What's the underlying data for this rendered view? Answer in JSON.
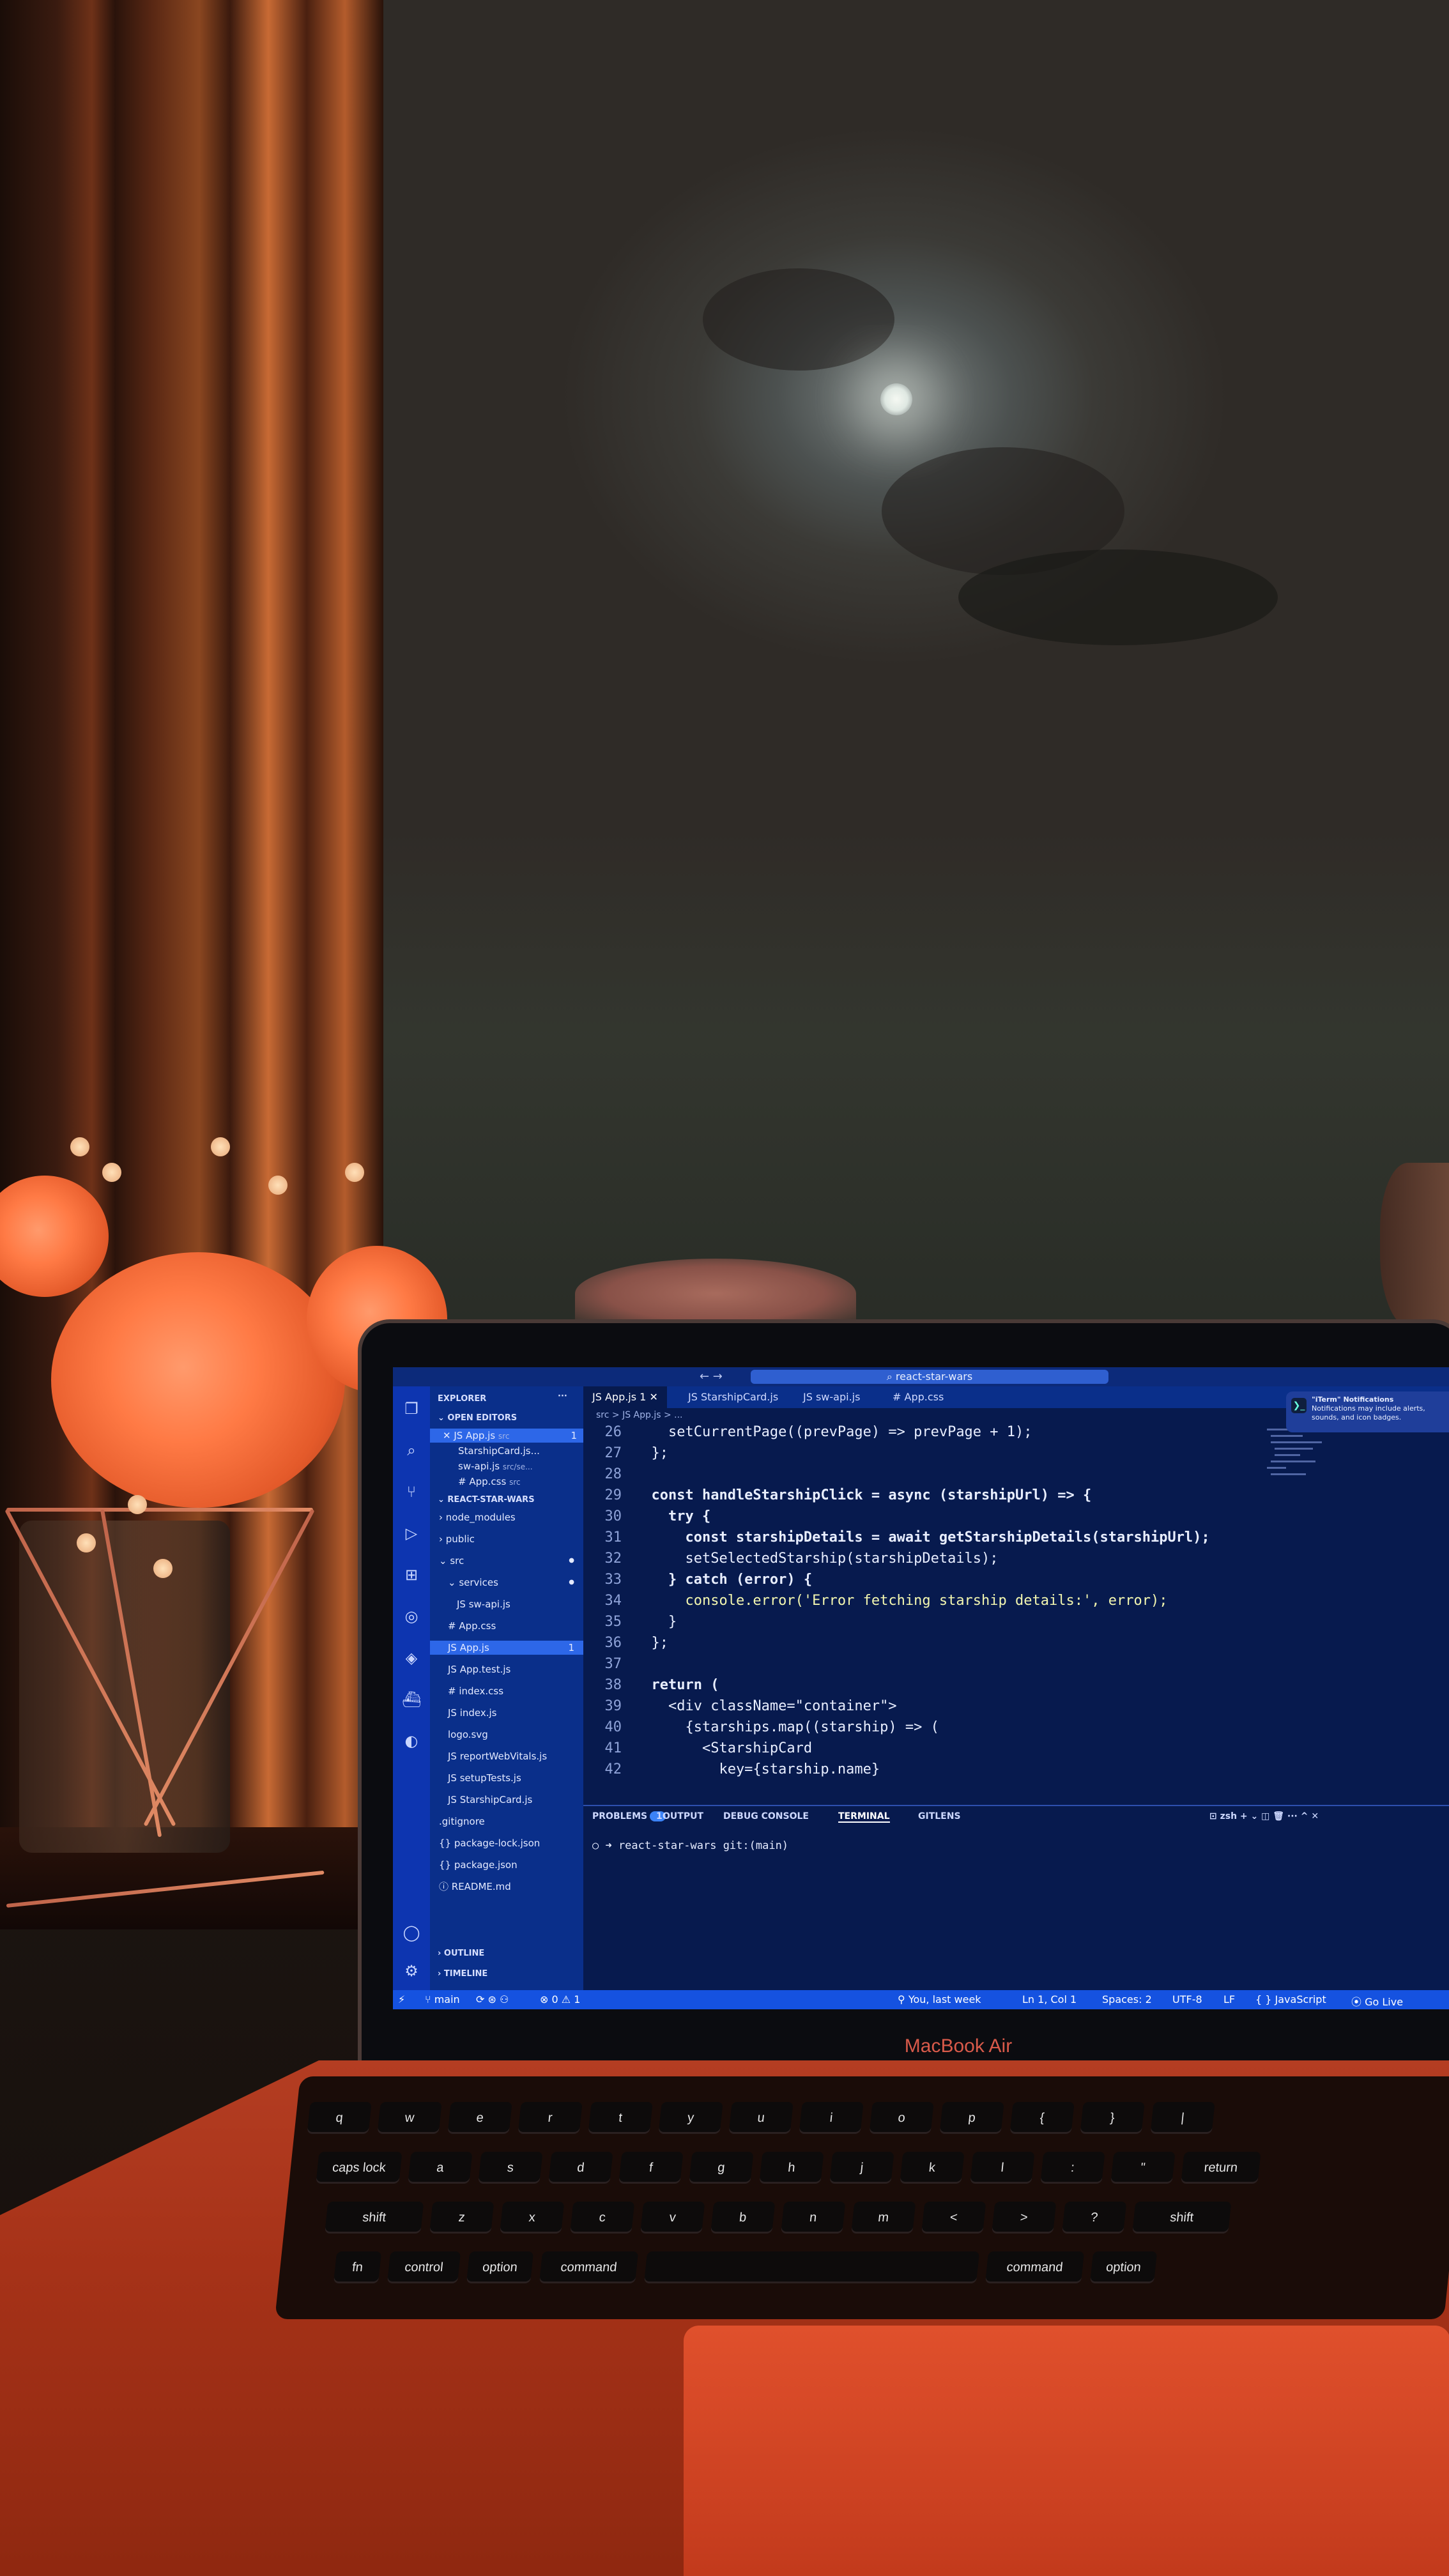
{
  "scene": {
    "laptop_brand": "MacBook Air"
  },
  "vscode": {
    "title": "react-star-wars",
    "notification": {
      "title": "\"iTerm\" Notifications",
      "body": "Notifications may include alerts, sounds, and icon badges."
    },
    "sidebar": {
      "header": "EXPLORER",
      "header_more": "···",
      "open_editors_label": "OPEN EDITORS",
      "open_editors": [
        {
          "close": "✕",
          "name": "JS App.js",
          "path": "src",
          "badge": "1"
        },
        {
          "name": "StarshipCard.js...",
          "path": ""
        },
        {
          "name": "sw-api.js",
          "path": "src/se..."
        },
        {
          "name": "# App.css",
          "path": "src"
        }
      ],
      "project_label": "REACT-STAR-WARS",
      "tree": [
        {
          "name": "node_modules",
          "indent": 0,
          "arrow": "›"
        },
        {
          "name": "public",
          "indent": 0,
          "arrow": "›"
        },
        {
          "name": "src",
          "indent": 0,
          "arrow": "⌄",
          "dot": "●"
        },
        {
          "name": "services",
          "indent": 1,
          "arrow": "⌄",
          "dot": "●"
        },
        {
          "name": "JS sw-api.js",
          "indent": 2
        },
        {
          "name": "# App.css",
          "indent": 1
        },
        {
          "name": "JS App.js",
          "indent": 1,
          "active": true,
          "badge": "1"
        },
        {
          "name": "JS App.test.js",
          "indent": 1
        },
        {
          "name": "# index.css",
          "indent": 1
        },
        {
          "name": "JS index.js",
          "indent": 1
        },
        {
          "name": "logo.svg",
          "indent": 1
        },
        {
          "name": "JS reportWebVitals.js",
          "indent": 1
        },
        {
          "name": "JS setupTests.js",
          "indent": 1
        },
        {
          "name": "JS StarshipCard.js",
          "indent": 1
        },
        {
          "name": ".gitignore",
          "indent": 0
        },
        {
          "name": "{} package-lock.json",
          "indent": 0
        },
        {
          "name": "{} package.json",
          "indent": 0
        },
        {
          "name": "ⓘ README.md",
          "indent": 0
        }
      ],
      "outline_label": "OUTLINE",
      "timeline_label": "TIMELINE"
    },
    "tabs": [
      {
        "label": "JS App.js",
        "badge": "1 ✕",
        "active": true
      },
      {
        "label": "JS StarshipCard.js"
      },
      {
        "label": "JS sw-api.js"
      },
      {
        "label": "# App.css"
      }
    ],
    "breadcrumb": "src > JS App.js > ...",
    "code_lines": [
      {
        "n": "26",
        "t": "    setCurrentPage((prevPage) => prevPage + 1);"
      },
      {
        "n": "27",
        "t": "  };"
      },
      {
        "n": "28",
        "t": ""
      },
      {
        "n": "29",
        "t": "  const handleStarshipClick = async (starshipUrl) => {"
      },
      {
        "n": "30",
        "t": "    try {"
      },
      {
        "n": "31",
        "t": "      const starshipDetails = await getStarshipDetails(starshipUrl);"
      },
      {
        "n": "32",
        "t": "      setSelectedStarship(starshipDetails);"
      },
      {
        "n": "33",
        "t": "    } catch (error) {"
      },
      {
        "n": "34",
        "t": "      console.error('Error fetching starship details:', error);"
      },
      {
        "n": "35",
        "t": "    }"
      },
      {
        "n": "36",
        "t": "  };"
      },
      {
        "n": "37",
        "t": ""
      },
      {
        "n": "38",
        "t": "  return ("
      },
      {
        "n": "39",
        "t": "    <div className=\"container\">"
      },
      {
        "n": "40",
        "t": "      {starships.map((starship) => ("
      },
      {
        "n": "41",
        "t": "        <StarshipCard"
      },
      {
        "n": "42",
        "t": "          key={starship.name}"
      }
    ],
    "panel": {
      "tabs": [
        "PROBLEMS",
        "OUTPUT",
        "DEBUG CONSOLE",
        "TERMINAL",
        "GITLENS"
      ],
      "problems_badge": "1",
      "active_tab": "TERMINAL",
      "shell": "zsh",
      "terminal_prompt": "○ ➜  react-star-wars git:(main)"
    },
    "statusbar": {
      "branch": "main",
      "problems": "⊗ 0 ⚠ 1",
      "blame": "You, last week",
      "position": "Ln 1, Col 1",
      "spaces": "Spaces: 2",
      "encoding": "UTF-8",
      "eol": "LF",
      "language": "{ } JavaScript",
      "golive": "Go Live"
    }
  },
  "keyboard": {
    "rows": [
      [
        "q",
        "w",
        "e",
        "r",
        "t",
        "y",
        "u",
        "i",
        "o",
        "p",
        "{",
        "}",
        "|"
      ],
      [
        "caps lock",
        "a",
        "s",
        "d",
        "f",
        "g",
        "h",
        "j",
        "k",
        "l",
        ":",
        "\"",
        "return"
      ],
      [
        "shift",
        "z",
        "x",
        "c",
        "v",
        "b",
        "n",
        "m",
        "<",
        ">",
        "?",
        "shift"
      ],
      [
        "fn",
        "control",
        "option",
        "command",
        "",
        "command",
        "option"
      ]
    ]
  },
  "colors": {
    "vscode_blue": "#0a2f8a",
    "statusbar_blue": "#1552e0",
    "laptop_red": "#b43d22",
    "flower_orange": "#ff7a45"
  }
}
